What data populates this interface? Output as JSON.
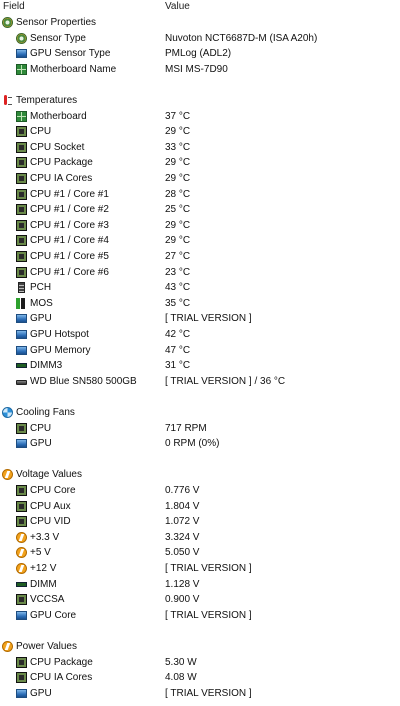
{
  "header": {
    "field": "Field",
    "value": "Value"
  },
  "rows": [
    {
      "kind": "section",
      "icon": "sensor-icon",
      "field": "Sensor Properties",
      "value": ""
    },
    {
      "kind": "item",
      "icon": "sensor-icon",
      "field": "Sensor Type",
      "value": "Nuvoton NCT6687D-M  (ISA A20h)"
    },
    {
      "kind": "item",
      "icon": "gpu-icon",
      "field": "GPU Sensor Type",
      "value": "PMLog  (ADL2)"
    },
    {
      "kind": "item",
      "icon": "motherboard-icon",
      "field": "Motherboard Name",
      "value": "MSI MS-7D90"
    },
    {
      "kind": "blank"
    },
    {
      "kind": "section",
      "icon": "thermometer-icon",
      "field": "Temperatures",
      "value": ""
    },
    {
      "kind": "item",
      "icon": "motherboard-icon",
      "field": "Motherboard",
      "value": "37 °C"
    },
    {
      "kind": "item",
      "icon": "chip-icon",
      "field": "CPU",
      "value": "29 °C"
    },
    {
      "kind": "item",
      "icon": "chip-icon",
      "field": "CPU Socket",
      "value": "33 °C"
    },
    {
      "kind": "item",
      "icon": "chip-icon",
      "field": "CPU Package",
      "value": "29 °C"
    },
    {
      "kind": "item",
      "icon": "chip-icon",
      "field": "CPU IA Cores",
      "value": "29 °C"
    },
    {
      "kind": "item",
      "icon": "chip-icon",
      "field": "CPU #1 / Core #1",
      "value": "28 °C"
    },
    {
      "kind": "item",
      "icon": "chip-icon",
      "field": "CPU #1 / Core #2",
      "value": "25 °C"
    },
    {
      "kind": "item",
      "icon": "chip-icon",
      "field": "CPU #1 / Core #3",
      "value": "29 °C"
    },
    {
      "kind": "item",
      "icon": "chip-icon",
      "field": "CPU #1 / Core #4",
      "value": "29 °C"
    },
    {
      "kind": "item",
      "icon": "chip-icon",
      "field": "CPU #1 / Core #5",
      "value": "27 °C"
    },
    {
      "kind": "item",
      "icon": "chip-icon",
      "field": "CPU #1 / Core #6",
      "value": "23 °C"
    },
    {
      "kind": "item",
      "icon": "pch-icon",
      "field": "PCH",
      "value": "43 °C"
    },
    {
      "kind": "item",
      "icon": "mos-icon",
      "field": "MOS",
      "value": "35 °C"
    },
    {
      "kind": "item",
      "icon": "gpu-icon",
      "field": "GPU",
      "value": "[ TRIAL VERSION ]"
    },
    {
      "kind": "item",
      "icon": "gpu-icon",
      "field": "GPU Hotspot",
      "value": "42 °C"
    },
    {
      "kind": "item",
      "icon": "gpu-icon",
      "field": "GPU Memory",
      "value": "47 °C"
    },
    {
      "kind": "item",
      "icon": "dimm-icon",
      "field": "DIMM3",
      "value": "31 °C"
    },
    {
      "kind": "item",
      "icon": "disk-icon",
      "field": "WD Blue SN580 500GB",
      "value": "[ TRIAL VERSION ] / 36 °C"
    },
    {
      "kind": "blank"
    },
    {
      "kind": "section",
      "icon": "fan-icon",
      "field": "Cooling Fans",
      "value": ""
    },
    {
      "kind": "item",
      "icon": "chip-icon",
      "field": "CPU",
      "value": "717 RPM"
    },
    {
      "kind": "item",
      "icon": "gpu-icon",
      "field": "GPU",
      "value": "0 RPM  (0%)"
    },
    {
      "kind": "blank"
    },
    {
      "kind": "section",
      "icon": "voltage-icon",
      "field": "Voltage Values",
      "value": ""
    },
    {
      "kind": "item",
      "icon": "chip-icon",
      "field": "CPU Core",
      "value": "0.776 V"
    },
    {
      "kind": "item",
      "icon": "chip-icon",
      "field": "CPU Aux",
      "value": "1.804 V"
    },
    {
      "kind": "item",
      "icon": "chip-icon",
      "field": "CPU VID",
      "value": "1.072 V"
    },
    {
      "kind": "item",
      "icon": "voltage-icon",
      "field": "+3.3 V",
      "value": "3.324 V"
    },
    {
      "kind": "item",
      "icon": "voltage-icon",
      "field": "+5 V",
      "value": "5.050 V"
    },
    {
      "kind": "item",
      "icon": "voltage-icon",
      "field": "+12 V",
      "value": "[ TRIAL VERSION ]"
    },
    {
      "kind": "item",
      "icon": "dimm-icon",
      "field": "DIMM",
      "value": "1.128 V"
    },
    {
      "kind": "item",
      "icon": "chip-icon",
      "field": "VCCSA",
      "value": "0.900 V"
    },
    {
      "kind": "item",
      "icon": "gpu-icon",
      "field": "GPU Core",
      "value": "[ TRIAL VERSION ]"
    },
    {
      "kind": "blank"
    },
    {
      "kind": "section",
      "icon": "voltage-icon",
      "field": "Power Values",
      "value": ""
    },
    {
      "kind": "item",
      "icon": "chip-icon",
      "field": "CPU Package",
      "value": "5.30 W"
    },
    {
      "kind": "item",
      "icon": "chip-icon",
      "field": "CPU IA Cores",
      "value": "4.08 W"
    },
    {
      "kind": "item",
      "icon": "gpu-icon",
      "field": "GPU",
      "value": "[ TRIAL VERSION ]"
    }
  ]
}
